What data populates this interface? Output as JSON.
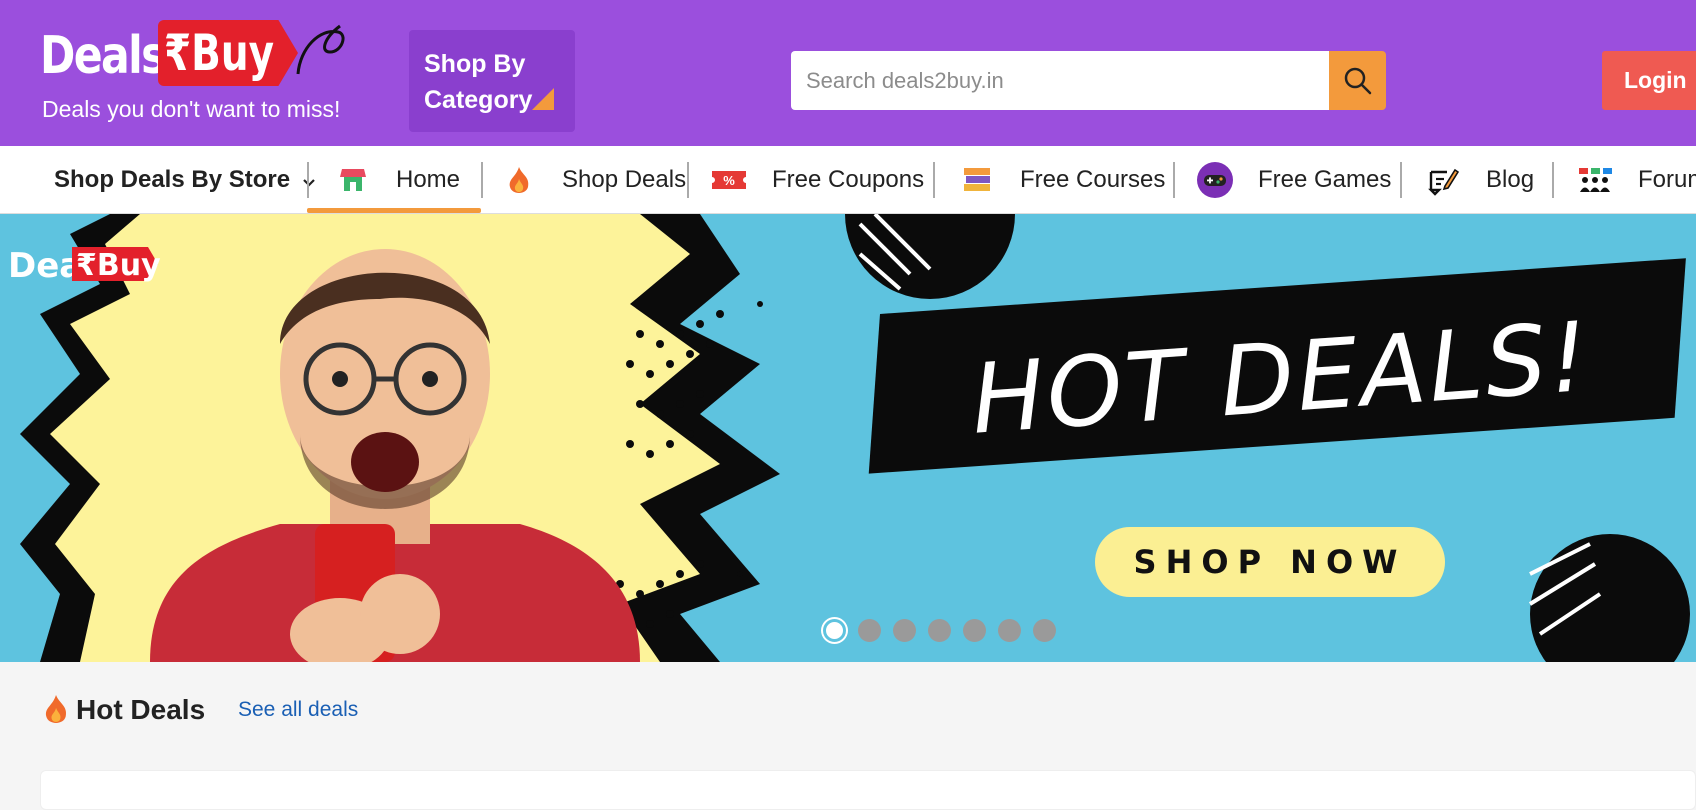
{
  "header": {
    "logo": {
      "text_deals": "Deals",
      "text_buy": "₹Buy"
    },
    "tagline": "Deals you don't want to miss!",
    "category_button": {
      "line1": "Shop By",
      "line2": "Category"
    },
    "search": {
      "placeholder": "Search deals2buy.in",
      "icon": "search-icon"
    },
    "login_label": "Login"
  },
  "nav": {
    "store_dropdown": "Shop Deals By Store",
    "items": [
      {
        "label": "Home",
        "icon": "storefront-icon",
        "active": true
      },
      {
        "label": "Shop Deals",
        "icon": "flame-icon"
      },
      {
        "label": "Free Coupons",
        "icon": "coupon-icon"
      },
      {
        "label": "Free Courses",
        "icon": "books-icon"
      },
      {
        "label": "Free Games",
        "icon": "gamepad-icon"
      },
      {
        "label": "Blog",
        "icon": "edit-note-icon"
      },
      {
        "label": "Forum",
        "icon": "people-icon"
      }
    ]
  },
  "banner": {
    "headline": "HOT DEALS!",
    "cta": "SHOP NOW",
    "slide_count": 7,
    "active_slide": 1
  },
  "hot_deals": {
    "title": "Hot Deals",
    "see_all": "See all deals"
  },
  "colors": {
    "header_bg": "#9b4fdd",
    "accent_orange": "#f39a3c",
    "login_red": "#ef5a52",
    "banner_bg": "#5ec3df",
    "link_blue": "#1a5fb4"
  }
}
